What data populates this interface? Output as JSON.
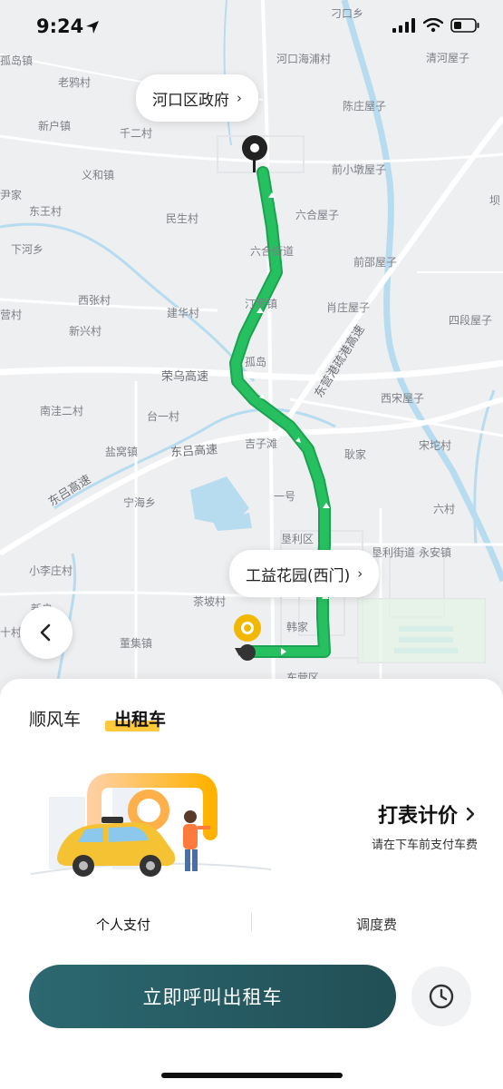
{
  "status_bar": {
    "time": "9:24"
  },
  "map": {
    "place_labels": [
      "刁口乡",
      "孤岛镇",
      "河口海浦村",
      "清河屋子",
      "老鸦村",
      "陈庄屋子",
      "新户镇",
      "千二村",
      "义和镇",
      "前小墩屋子",
      "东王村",
      "民生村",
      "六合屋子",
      "下河乡",
      "六合街道",
      "前邵屋子",
      "西张村",
      "汀罗镇",
      "肖庄屋子",
      "四段屋子",
      "营村",
      "建华村",
      "新兴村",
      "孤岛",
      "南洼二村",
      "台一村",
      "西宋屋子",
      "盐窝镇",
      "吉子滩",
      "宋坨村",
      "耿家",
      "一号",
      "宁海乡",
      "六村",
      "垦利区",
      "永安镇",
      "小李庄村",
      "新户",
      "茶坡村",
      "韩家",
      "董集镇",
      "东营区",
      "垦利街道",
      "尹家",
      "十村",
      "坝"
    ],
    "road_labels": [
      "荣乌高速",
      "东吕高速",
      "东吕高速",
      "东营港疏港高速"
    ],
    "origin_callout": "河口区政府",
    "destination_callout": "工益花园(西门)"
  },
  "sheet": {
    "tab_carpool": "顺风车",
    "tab_taxi": "出租车",
    "meter_title": "打表计价",
    "meter_subtitle": "请在下车前支付车费",
    "pay_personal": "个人支付",
    "pay_dispatch": "调度费",
    "call_button": "立即呼叫出租车"
  },
  "colors": {
    "route": "#22b85a",
    "button": "#2a6068",
    "tab_highlight": "#ffc83d"
  }
}
